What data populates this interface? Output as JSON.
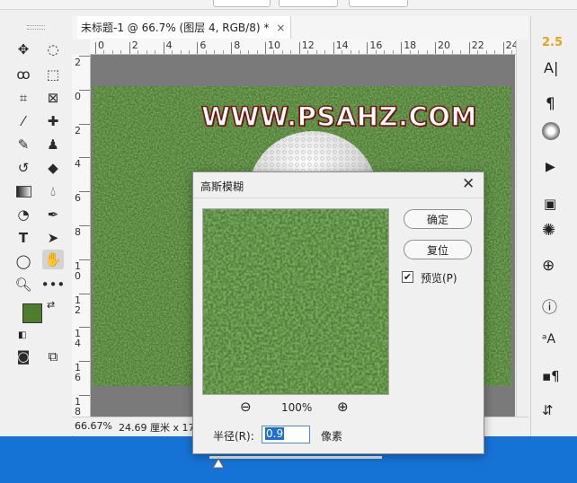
{
  "document": {
    "tab_title": "未标题-1 @ 66.7% (图层 4, RGB/8) *",
    "close_glyph": "×",
    "canvas_text": "WWW.PSAHZ.COM",
    "h_ruler_ticks": [
      "0",
      "2",
      "4",
      "6",
      "8",
      "10",
      "12",
      "14",
      "16",
      "18",
      "20",
      "22",
      "24"
    ],
    "v_ruler_ticks": [
      "2",
      "0",
      "2",
      "4",
      "6",
      "8",
      "1 0",
      "1 2",
      "1 4",
      "1 6",
      "1 8"
    ]
  },
  "status": {
    "zoom": "66.67%",
    "size": "24.69 厘米 x 17."
  },
  "toolbar": {
    "foreground_color": "#4f7d2e",
    "background_color": "#ffffff"
  },
  "right_panel": {
    "font_size_value": "2.5",
    "accent": "#e8a317"
  },
  "dialog": {
    "title": "高斯模糊",
    "ok_label": "确定",
    "reset_label": "复位",
    "preview_label": "预览(P)",
    "preview_checked": true,
    "zoom_percent": "100%",
    "radius_label": "半径(R):",
    "radius_value": "0.9",
    "radius_unit": "像素",
    "radius_slider_fraction": 0.05
  },
  "taskbar": {
    "color": "#1673d6"
  }
}
